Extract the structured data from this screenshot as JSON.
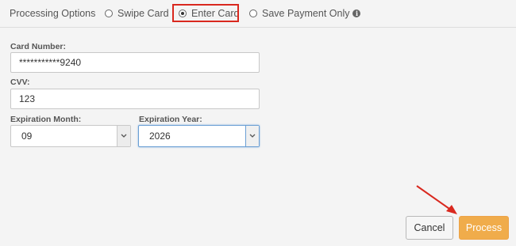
{
  "processing_options": {
    "title": "Processing Options",
    "options": [
      {
        "label": "Swipe Card",
        "selected": false
      },
      {
        "label": "Enter Card",
        "selected": true
      },
      {
        "label": "Save Payment Only",
        "selected": false
      }
    ],
    "info_icon": "info-icon"
  },
  "form": {
    "card_number": {
      "label": "Card Number:",
      "value": "***********9240"
    },
    "cvv": {
      "label": "CVV:",
      "value": "123"
    },
    "expiration_month": {
      "label": "Expiration Month:",
      "value": "09"
    },
    "expiration_year": {
      "label": "Expiration Year:",
      "value": "2026"
    }
  },
  "buttons": {
    "cancel": "Cancel",
    "process": "Process"
  },
  "colors": {
    "highlight": "#d9281e",
    "process_button": "#f0ac4b",
    "annotation_arrow": "#d9281e"
  }
}
